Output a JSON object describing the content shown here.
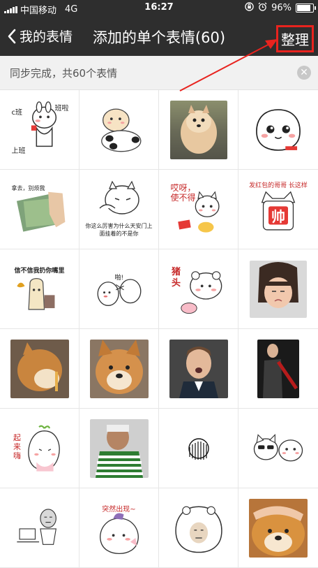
{
  "status": {
    "carrier": "中国移动",
    "network": "4G",
    "time": "16:27",
    "battery": "96%",
    "battery_level": 0.96
  },
  "nav": {
    "back_label": "我的表情",
    "title": "添加的单个表情(60)",
    "manage_label": "整理"
  },
  "sync": {
    "message": "同步完成，共60个表情",
    "close_icon": "close-icon"
  },
  "stickers": {
    "r2c1_caption": "拿去，别烦我",
    "r2c2_caption": "你这么厉害为什么天安门上面挂着的不是你",
    "r2c3_caption": "哎呀，使不得",
    "r2c4_caption": "发红包的哥哥 长这样",
    "r2c4_big": "帅",
    "r3c1_caption": "信不信我扔你嘴里",
    "r3c3_caption": "猪头",
    "r5c1_caption": "起来嗨",
    "r6c2_caption": "突然出现~",
    "r1c1_text_left": "c班",
    "r1c1_text_right": "班啦",
    "r1c1_text_bottom": "上班",
    "r3c2_text": "啪!"
  },
  "colors": {
    "accent_red": "#e8231e",
    "nav_bg": "#2e2e2e"
  }
}
